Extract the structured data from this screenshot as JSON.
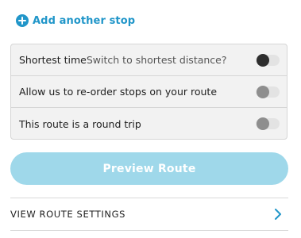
{
  "add_stop": {
    "label": "Add another stop",
    "icon": "plus-circle-icon",
    "color": "#2196c9"
  },
  "options": [
    {
      "label": "Shortest time",
      "sub_label": "Switch to shortest distance?",
      "toggle_state": "off-dark"
    },
    {
      "label": "Allow us to re-order stops on your route",
      "toggle_state": "off"
    },
    {
      "label": "This route is a round trip",
      "toggle_state": "off"
    }
  ],
  "preview_button": {
    "label": "Preview Route",
    "state": "disabled",
    "color": "#9fd8ea"
  },
  "settings": {
    "label": "VIEW ROUTE SETTINGS",
    "icon": "chevron-right-icon"
  }
}
